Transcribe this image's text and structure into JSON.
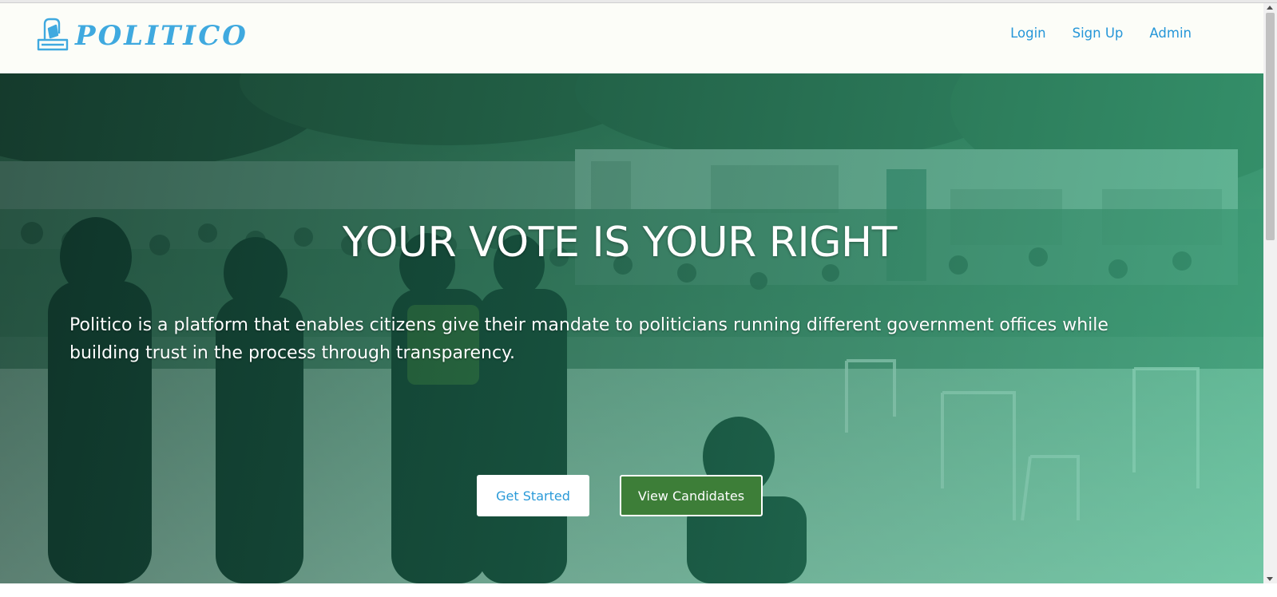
{
  "brand": {
    "name": "POLITICO",
    "icon": "ballot-box-icon",
    "color": "#3fa9df"
  },
  "nav": {
    "items": [
      {
        "label": "Login"
      },
      {
        "label": "Sign Up"
      },
      {
        "label": "Admin"
      }
    ],
    "color": "#2596d8"
  },
  "hero": {
    "title": "YOUR VOTE IS YOUR RIGHT",
    "description": "Politico is a platform that enables citizens give their mandate to politicians running different government offices while building trust in the process through transparency.",
    "primary_button": "Get Started",
    "secondary_button": "View Candidates",
    "overlay_colors": [
      "#0a2a23",
      "#1d6a50",
      "#3cb98c"
    ],
    "button_green": "#3d7e38"
  }
}
